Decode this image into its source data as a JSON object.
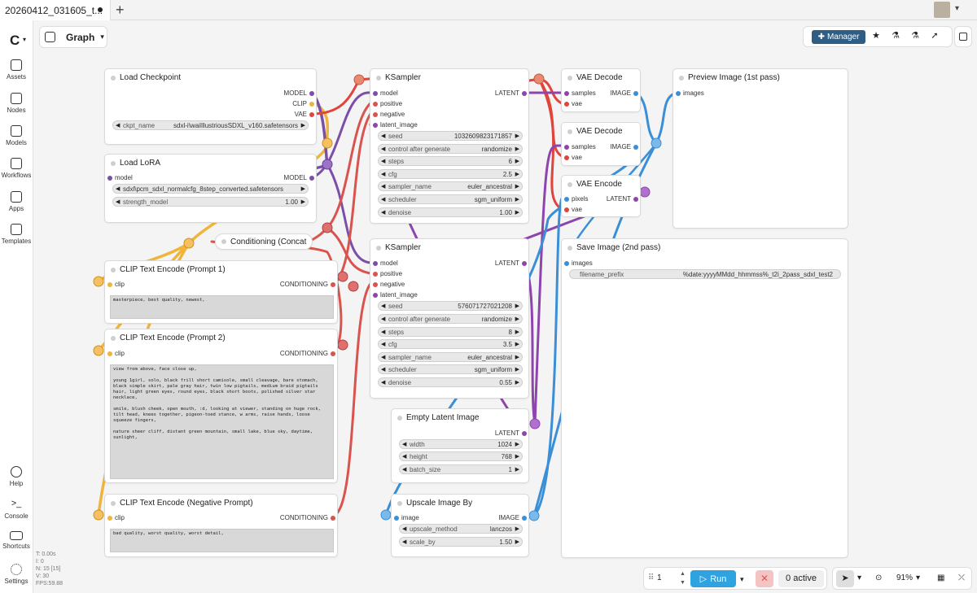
{
  "tab": {
    "title": "20260412_031605_t..."
  },
  "sidebar": {
    "items": [
      {
        "label": "Assets",
        "icon": "image-icon"
      },
      {
        "label": "Nodes",
        "icon": "plug-icon"
      },
      {
        "label": "Models",
        "icon": "models-icon"
      },
      {
        "label": "Workflows",
        "icon": "workflow-icon"
      },
      {
        "label": "Apps",
        "icon": "app-icon"
      },
      {
        "label": "Templates",
        "icon": "template-icon"
      }
    ],
    "bottom": [
      {
        "label": "Help",
        "icon": "help-icon"
      },
      {
        "label": "Console",
        "icon": "terminal-icon"
      },
      {
        "label": "Shortcuts",
        "icon": "keyboard-icon"
      },
      {
        "label": "Settings",
        "icon": "gear-icon"
      }
    ]
  },
  "stats": [
    "T: 0.00s",
    "I: 0",
    "N: 15 [15]",
    "V: 30",
    "FPS:59.88"
  ],
  "graph": {
    "label": "Graph"
  },
  "toolbar": {
    "manager_label": "Manager"
  },
  "nodes": {
    "load_checkpoint": {
      "title": "Load Checkpoint",
      "outputs": [
        "MODEL",
        "CLIP",
        "VAE"
      ],
      "ckpt_name": "ckpt_name",
      "ckpt_value": "sdxl-i\\waiIllustriousSDXL_v160.safetensors"
    },
    "load_lora": {
      "title": "Load LoRA",
      "input": "model",
      "output": "MODEL",
      "lora_value": "sdxl\\pcm_sdxl_normalcfg_8step_converted.safetensors",
      "strength_name": "strength_model",
      "strength_value": "1.00"
    },
    "concat": {
      "title": "Conditioning (Concat"
    },
    "clip1": {
      "title": "CLIP Text Encode (Prompt 1)",
      "input": "clip",
      "output": "CONDITIONING",
      "text": "masterpiece, best quality, newest,"
    },
    "clip2": {
      "title": "CLIP Text Encode (Prompt 2)",
      "input": "clip",
      "output": "CONDITIONING",
      "text": "view from above, face close up,\n\nyoung 1girl, solo, black frill short camisole, small cleavage, bare stomach, black simple skirt, pale gray hair, twin low pigtails, medium braid pigtails hair, light green eyes, round eyes, black short boots, polished silver star necklace,\n\nsmile, blush cheek, open mouth, :d, looking at viewer, standing on huge rock, tilt head, knees together, pigeon-toed stance, w arms, raise hands, loose squeeze fingers,\n\nnature sheer cliff, distant green mountain, small lake, blue sky, daytime, sunlight,"
    },
    "clip_neg": {
      "title": "CLIP Text Encode (Negative Prompt)",
      "input": "clip",
      "output": "CONDITIONING",
      "text": "bad quality, worst quality, worst detail,"
    },
    "ksampler1": {
      "title": "KSampler",
      "inputs": [
        "model",
        "positive",
        "negative",
        "latent_image"
      ],
      "output": "LATENT",
      "widgets": [
        {
          "name": "seed",
          "value": "1032609823171857"
        },
        {
          "name": "control after generate",
          "value": "randomize"
        },
        {
          "name": "steps",
          "value": "6"
        },
        {
          "name": "cfg",
          "value": "2.5"
        },
        {
          "name": "sampler_name",
          "value": "euler_ancestral"
        },
        {
          "name": "scheduler",
          "value": "sgm_uniform"
        },
        {
          "name": "denoise",
          "value": "1.00"
        }
      ]
    },
    "ksampler2": {
      "title": "KSampler",
      "inputs": [
        "model",
        "positive",
        "negative",
        "latent_image"
      ],
      "output": "LATENT",
      "widgets": [
        {
          "name": "seed",
          "value": "576071727021208"
        },
        {
          "name": "control after generate",
          "value": "randomize"
        },
        {
          "name": "steps",
          "value": "8"
        },
        {
          "name": "cfg",
          "value": "3.5"
        },
        {
          "name": "sampler_name",
          "value": "euler_ancestral"
        },
        {
          "name": "scheduler",
          "value": "sgm_uniform"
        },
        {
          "name": "denoise",
          "value": "0.55"
        }
      ]
    },
    "empty_latent": {
      "title": "Empty Latent Image",
      "output": "LATENT",
      "widgets": [
        {
          "name": "width",
          "value": "1024"
        },
        {
          "name": "height",
          "value": "768"
        },
        {
          "name": "batch_size",
          "value": "1"
        }
      ]
    },
    "upscale": {
      "title": "Upscale Image By",
      "input": "image",
      "output": "IMAGE",
      "widgets": [
        {
          "name": "upscale_method",
          "value": "lanczos"
        },
        {
          "name": "scale_by",
          "value": "1.50"
        }
      ]
    },
    "vae_decode1": {
      "title": "VAE Decode",
      "inputs": [
        "samples",
        "vae"
      ],
      "output": "IMAGE"
    },
    "vae_decode2": {
      "title": "VAE Decode",
      "inputs": [
        "samples",
        "vae"
      ],
      "output": "IMAGE"
    },
    "vae_encode": {
      "title": "VAE Encode",
      "inputs": [
        "pixels",
        "vae"
      ],
      "output": "LATENT"
    },
    "preview": {
      "title": "Preview Image (1st pass)",
      "input": "images"
    },
    "save": {
      "title": "Save Image (2nd pass)",
      "input": "images",
      "prefix_name": "filename_prefix",
      "prefix_value": "%date:yyyyMMdd_hhmmss%_t2i_2pass_sdxl_test2"
    }
  },
  "runbar": {
    "batch_count": "1",
    "run_label": "Run",
    "queue_label": "0 active"
  },
  "canvas": {
    "zoom": "91%"
  },
  "colors": {
    "model": "#7b4fa8",
    "clip": "#f0b43a",
    "vae": "#e0453c",
    "conditioning": "#d9534f",
    "latent": "#8e44ad",
    "image": "#3a8fd6"
  }
}
